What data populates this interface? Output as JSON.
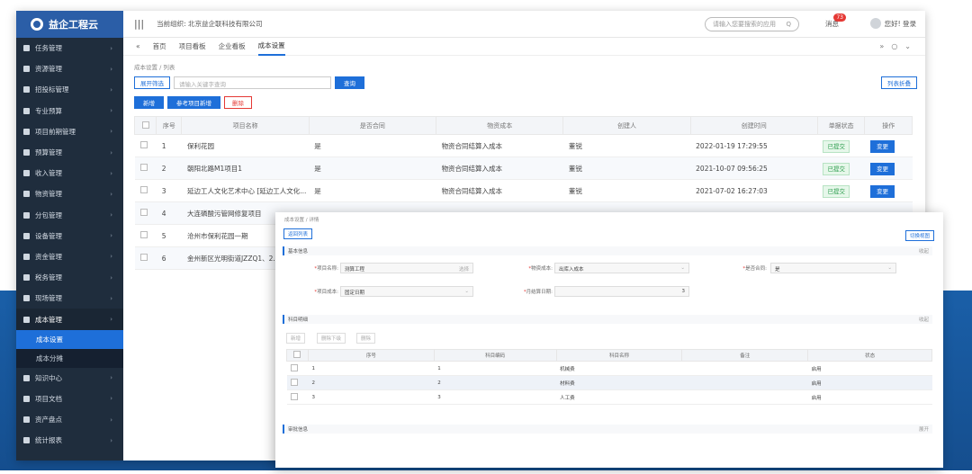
{
  "app": {
    "logo": "益企工程云"
  },
  "sidebar": {
    "items": [
      {
        "label": "任务管理"
      },
      {
        "label": "资源管理"
      },
      {
        "label": "招投标管理"
      },
      {
        "label": "专业预算"
      },
      {
        "label": "项目前期管理"
      },
      {
        "label": "预算管理"
      },
      {
        "label": "收入管理"
      },
      {
        "label": "物资管理"
      },
      {
        "label": "分包管理"
      },
      {
        "label": "设备管理"
      },
      {
        "label": "资金管理"
      },
      {
        "label": "税务管理"
      },
      {
        "label": "现场管理"
      },
      {
        "label": "成本管理"
      }
    ],
    "sub_items": [
      {
        "label": "成本设置"
      },
      {
        "label": "成本分摊"
      }
    ],
    "bottom_items": [
      {
        "label": "知识中心"
      },
      {
        "label": "项目文档"
      },
      {
        "label": "资产盘点"
      },
      {
        "label": "统计报表"
      }
    ]
  },
  "topbar": {
    "org_label": "当前组织: 北京益企联科技有限公司",
    "search_placeholder": "请输入您要搜索的应用",
    "msg_label": "消息",
    "msg_count": "73",
    "user_label": "您好! 登录"
  },
  "tabs": [
    {
      "label": "首页"
    },
    {
      "label": "项目看板"
    },
    {
      "label": "企业看板"
    },
    {
      "label": "成本设置"
    }
  ],
  "breadcrumb": "成本设置 / 列表",
  "filter": {
    "expand_label": "展开筛选",
    "input_placeholder": "请输入关键字查询",
    "search_label": "查询",
    "extra_label": "列表折叠"
  },
  "actions": {
    "add_label": "新增",
    "ref_label": "参考项目新增",
    "delete_label": "删除"
  },
  "table": {
    "headers": [
      "序号",
      "项目名称",
      "是否合同",
      "物资成本",
      "创建人",
      "创建时间",
      "单据状态",
      "操作"
    ],
    "rows": [
      {
        "no": "1",
        "name": "保利花园",
        "contract": "是",
        "cost": "物资合同结算入成本",
        "creator": "董锐",
        "time": "2022-01-19 17:29:55",
        "status": "已提交",
        "op": "变更"
      },
      {
        "no": "2",
        "name": "朝阳北路M1项目1",
        "contract": "是",
        "cost": "物资合同结算入成本",
        "creator": "董锐",
        "time": "2021-10-07 09:56:25",
        "status": "已提交",
        "op": "变更"
      },
      {
        "no": "3",
        "name": "延边工人文化艺术中心 [延边工人文化...",
        "contract": "是",
        "cost": "物资合同结算入成本",
        "creator": "董锐",
        "time": "2021-07-02 16:27:03",
        "status": "已提交",
        "op": "变更"
      },
      {
        "no": "4",
        "name": "大连磷酸污管网修复项目",
        "contract": "",
        "cost": "",
        "creator": "",
        "time": "",
        "status": "",
        "op": ""
      },
      {
        "no": "5",
        "name": "沧州市保利花园一期",
        "contract": "",
        "cost": "",
        "creator": "",
        "time": "",
        "status": "",
        "op": ""
      },
      {
        "no": "6",
        "name": "金州新区光明街道JZZQ1、2...",
        "contract": "",
        "cost": "",
        "creator": "",
        "time": "",
        "status": "",
        "op": ""
      }
    ]
  },
  "detail": {
    "breadcrumb": "成本设置 / 详情",
    "back_label": "返回列表",
    "right_button": "切换视图",
    "basic_section": "基本信息",
    "collapse": "收起",
    "fields": {
      "project_label": "项目名称:",
      "project_value": "测算工程",
      "project_btn": "选择",
      "material_label": "物资成本:",
      "material_value": "出库入成本",
      "contract_label": "是否合同:",
      "contract_value": "是",
      "method_label": "项目成本:",
      "method_value": "固定日期",
      "day_label": "月结算日期:",
      "day_value": "3"
    },
    "subject_section": "科目明细",
    "sub_buttons": [
      "新增",
      "删除下级",
      "删除"
    ],
    "sub_headers": [
      "序号",
      "科目编码",
      "科目名称",
      "备注",
      "状态"
    ],
    "sub_rows": [
      {
        "no": "1",
        "code": "1",
        "name": "机械费",
        "note": "",
        "state": "启用"
      },
      {
        "no": "2",
        "code": "2",
        "name": "材料费",
        "note": "",
        "state": "启用"
      },
      {
        "no": "3",
        "code": "3",
        "name": "人工费",
        "note": "",
        "state": "启用"
      }
    ],
    "approval_section": "审批信息",
    "expand": "展开"
  }
}
